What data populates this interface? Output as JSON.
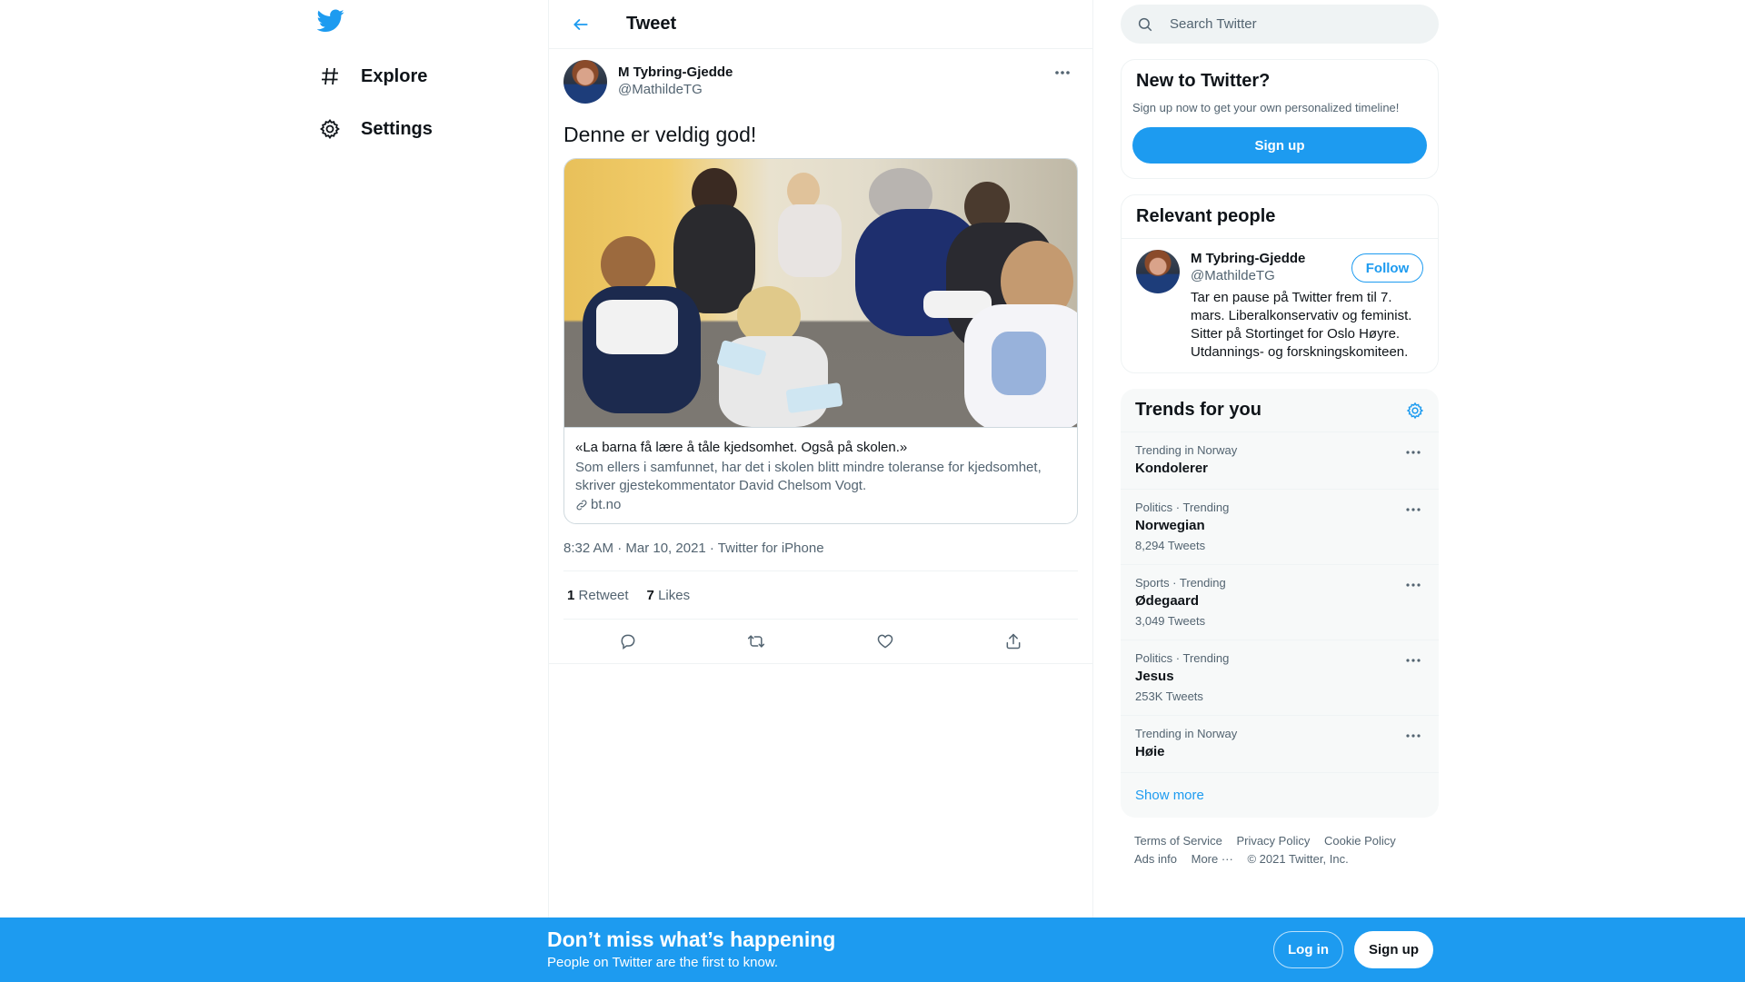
{
  "nav": {
    "items": [
      {
        "label": "Explore",
        "icon": "hashtag-icon"
      },
      {
        "label": "Settings",
        "icon": "gear-icon"
      }
    ]
  },
  "header": {
    "title": "Tweet"
  },
  "tweet": {
    "author_name": "M Tybring-Gjedde",
    "author_handle": "@MathildeTG",
    "text": "Denne er veldig god!",
    "card": {
      "title": "«La barna få lære å tåle kjedsomhet. Også på skolen.»",
      "description": "Som ellers i samfunnet, har det i skolen blitt mindre toleranse for kjedsomhet, skriver gjestekommentator David Chelsom Vogt.",
      "domain": "bt.no"
    },
    "meta": "8:32 AM · Mar 10, 2021 · Twitter for iPhone",
    "retweets_count": "1",
    "retweets_label": "Retweet",
    "likes_count": "7",
    "likes_label": "Likes"
  },
  "search": {
    "placeholder": "Search Twitter"
  },
  "new_to_twitter": {
    "title": "New to Twitter?",
    "description": "Sign up now to get your own personalized timeline!",
    "button": "Sign up"
  },
  "relevant_people": {
    "title": "Relevant people",
    "name": "M Tybring-Gjedde",
    "handle": "@MathildeTG",
    "bio": "Tar en pause på Twitter frem til 7. mars. Liberalkonservativ og feminist. Sitter på Stortinget for Oslo Høyre. Utdannings- og forskningskomiteen.",
    "follow": "Follow"
  },
  "trends": {
    "title": "Trends for you",
    "items": [
      {
        "meta": "Trending in Norway",
        "name": "Kondolerer",
        "count": ""
      },
      {
        "meta": "Politics · Trending",
        "name": "Norwegian",
        "count": "8,294 Tweets"
      },
      {
        "meta": "Sports · Trending",
        "name": "Ødegaard",
        "count": "3,049 Tweets"
      },
      {
        "meta": "Politics · Trending",
        "name": "Jesus",
        "count": "253K Tweets"
      },
      {
        "meta": "Trending in Norway",
        "name": "Høie",
        "count": ""
      }
    ],
    "show_more": "Show more"
  },
  "footer": {
    "links": [
      "Terms of Service",
      "Privacy Policy",
      "Cookie Policy",
      "Ads info",
      "More ···",
      "© 2021 Twitter, Inc."
    ]
  },
  "bottom_bar": {
    "title": "Don’t miss what’s happening",
    "subtitle": "People on Twitter are the first to know.",
    "login": "Log in",
    "signup": "Sign up"
  },
  "colors": {
    "accent": "#1d9bf0",
    "text": "#0f1419",
    "secondary": "#536471"
  }
}
